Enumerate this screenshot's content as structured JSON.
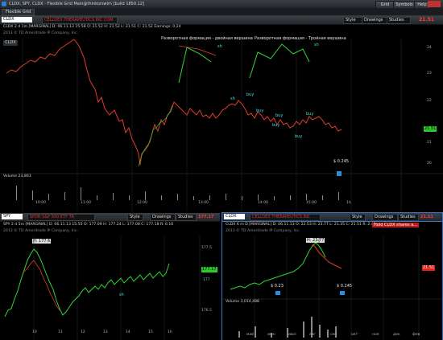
{
  "window": {
    "title": "CLDX, SPY, CLDX - Flexible Grid Main@thinkorswim [build 1850.12]",
    "tab": "Flexible Grid"
  },
  "top_panel": {
    "symbol": "CLDX",
    "company": "CELLDEX THERAPEUTICS INC COM",
    "info_line1": "CLDX 2 d 1m [MARGINAL]  D: 06.11.13 15:58  O: 21.52  H: 21.52  L: 21.51  C: 21.52  Earnings: 0.24",
    "info_line2": "2013 © TD Ameritrade IP Company, Inc.",
    "last_price": "21.51",
    "price_tag": "21.51",
    "buttons": [
      "Style",
      "Drawings",
      "Studies"
    ],
    "annotation_left": "Разворотная формация - двойная вершина",
    "annotation_right": "Разворотная формация - Тройная вершина",
    "labels": [
      "sh",
      "sh",
      "sh",
      "buy",
      "buy",
      "buy",
      "buy",
      "buy",
      "buy"
    ],
    "earnings_marker": "$ 0.245",
    "volume_label": "Volume  23,803",
    "y_ticks": [
      "24",
      "23",
      "22",
      "21",
      "20"
    ],
    "x_ticks": [
      "10:00",
      "11:00",
      "12:00",
      "13:00",
      "14:00",
      "15:00",
      "5d",
      "10:00",
      "11:00",
      "12:00",
      "13:00",
      "14:00",
      "15:00",
      "1h"
    ]
  },
  "bottom_left": {
    "symbol": "SPY",
    "company": "SPDR S&P 500 ETF TR",
    "last_price": "177.17",
    "info_line1": "SPY 2 d 5m [MARGINAL]  D: 06.11.13 15:55  O: 177.09  H: 177.24  L: 177.08  C: 177.18  R: 6.16",
    "info_line2": "2013 © TD Ameritrade IP Company, Inc.",
    "hi_label": "H: 177.6",
    "price_tag": "177.17",
    "label_sh": "sh",
    "y_ticks": [
      "177.5",
      "177",
      "176.5"
    ],
    "x_ticks": [
      "10",
      "11",
      "12",
      "13",
      "14",
      "15",
      "1h"
    ]
  },
  "bottom_right": {
    "symbol": "CLDX",
    "company": "CELLDEX THERAPEUTICS INC COM",
    "last_price": "21.51",
    "info_line1": "CLDX 6 m D [MARGINAL]  D: 06.11.13  O: 22.53  H: 23.77  L: 21.35  C: 21.51  R: 2.42",
    "info_line2": "2013 © TD Ameritrade IP Company, Inc.",
    "hold_label": "Hold CLDX shares a...",
    "hi_label": "H: 23.77",
    "price_tag": "21.51",
    "marker1": "$ 0.23",
    "marker2": "$ 0.245",
    "volume_label": "Volume  3,014,488",
    "x_ticks": [
      "май",
      "июн",
      "июл",
      "авг",
      "сен",
      "окт",
      "ноя",
      "дек",
      "фев"
    ]
  },
  "toolbar": {
    "right_buttons": [
      "Grid",
      "Symbols",
      "Help"
    ]
  },
  "colors": {
    "up": "#35d235",
    "down": "#e23b2b",
    "accent": "#3fe0e0",
    "price_tag_red": "#e0211c",
    "price_tag_green": "#2ec72e"
  }
}
